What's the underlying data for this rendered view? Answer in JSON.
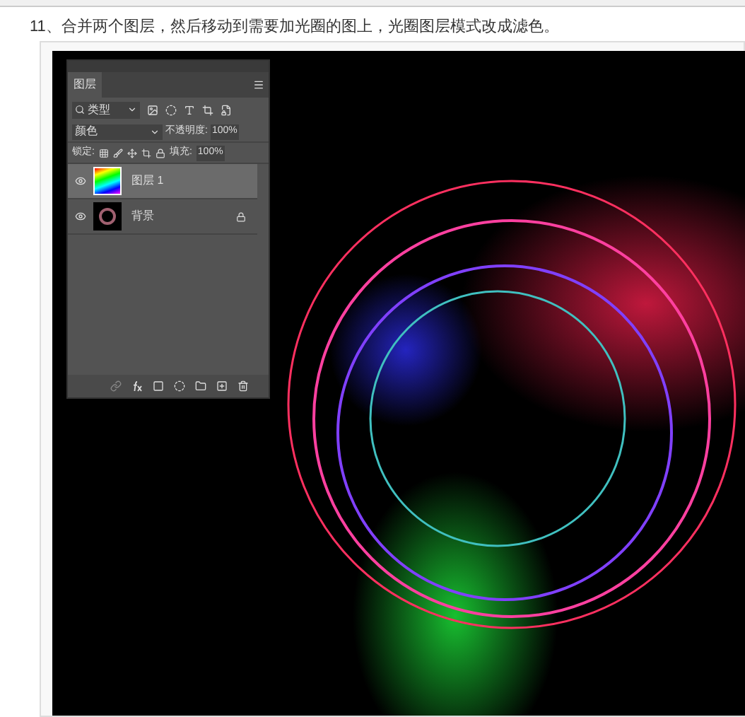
{
  "instruction": "11、合并两个图层，然后移动到需要加光圈的图上，光圈图层模式改成滤色。",
  "layers_panel": {
    "tab": "图层",
    "filter": "类型",
    "blend_mode": "颜色",
    "opacity_label": "不透明度:",
    "opacity": "100%",
    "lock_label": "锁定:",
    "fill_label": "填充:",
    "fill": "100%",
    "layers": [
      {
        "name": "图层 1",
        "kind": "rainbow",
        "selected": true,
        "visible": true,
        "locked": false
      },
      {
        "name": "背景",
        "kind": "rings",
        "selected": false,
        "visible": true,
        "locked": true
      }
    ]
  }
}
